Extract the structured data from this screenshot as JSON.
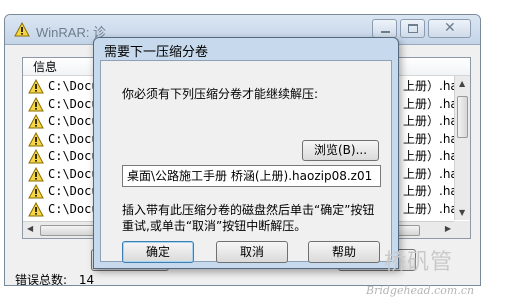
{
  "background_window": {
    "title": "WinRAR: 诊",
    "list_header": "信息",
    "rows": [
      {
        "path": "C:\\Docum",
        "right": "上册）.hao"
      },
      {
        "path": "C:\\Docum",
        "right": "上册）.hao"
      },
      {
        "path": "C:\\Docum",
        "right": "上册）.hao"
      },
      {
        "path": "C:\\Docum",
        "right": "上册）.hao"
      },
      {
        "path": "C:\\Docum",
        "right": "上册）.hao"
      },
      {
        "path": "C:\\Docum",
        "right": "上册）.hao"
      },
      {
        "path": "C:\\Docum",
        "right": "上册）.hao"
      },
      {
        "path": "C:\\Docum",
        "right": "上册）.hao"
      }
    ],
    "status_label": "错误总数:",
    "status_value": "14"
  },
  "dialog": {
    "title": "需要下一压缩分卷",
    "message": "你必须有下列压缩分卷才能继续解压:",
    "browse_label": "浏览(B)...",
    "path_value": "桌面\\公路施工手册 桥涵(上册).haozip08.z01",
    "instruction": "插入带有此压缩分卷的磁盘然后单击“确定”按钮重试,或单击“取消”按钮中断解压。",
    "ok_label": "确定",
    "cancel_label": "取消",
    "help_label": "帮助"
  },
  "watermark": {
    "logo": "桥矾管",
    "url": "Bridgehead.com.cn"
  },
  "icons": {
    "warning": "warning-triangle-icon",
    "minimize": "minimize-icon",
    "maximize": "maximize-icon",
    "close": "close-icon"
  }
}
